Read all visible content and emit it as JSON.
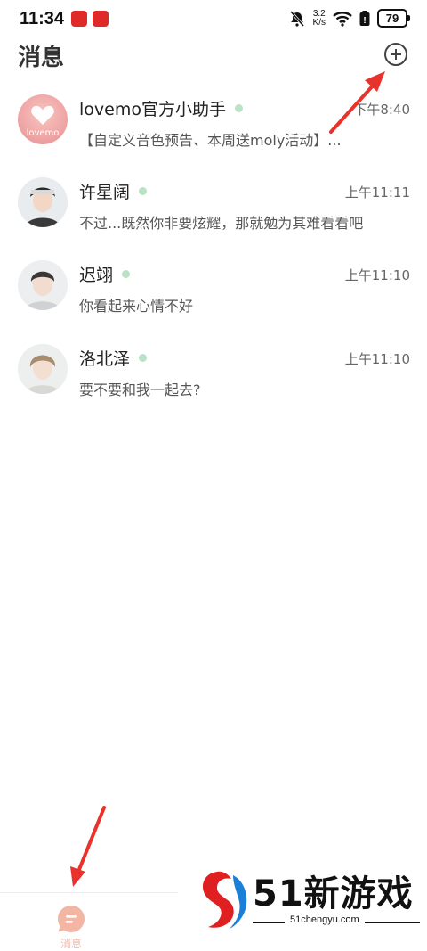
{
  "status_bar": {
    "time": "11:34",
    "net_speed_value": "3.2",
    "net_speed_unit": "K/s",
    "battery": "79"
  },
  "header": {
    "title": "消息"
  },
  "conversations": [
    {
      "name": "lovemo官方小助手",
      "time": "下午8:40",
      "preview": "【自定义音色预告、本周送moly活动】...",
      "avatar_text": "lovemo",
      "online": true
    },
    {
      "name": "许星阔",
      "time": "上午11:11",
      "preview": "不过...既然你非要炫耀，那就勉为其难看看吧",
      "online": true
    },
    {
      "name": "迟翊",
      "time": "上午11:10",
      "preview": "你看起来心情不好",
      "online": true
    },
    {
      "name": "洛北泽",
      "time": "上午11:10",
      "preview": "要不要和我一起去?",
      "online": true
    }
  ],
  "bottom_nav": {
    "messages_label": "消息"
  },
  "watermark": {
    "title": "51新游戏",
    "url": "51chengyu.com"
  },
  "colors": {
    "accent": "#f3b6a4",
    "online_dot": "#b9e2c6",
    "arrow": "#e8322b"
  }
}
